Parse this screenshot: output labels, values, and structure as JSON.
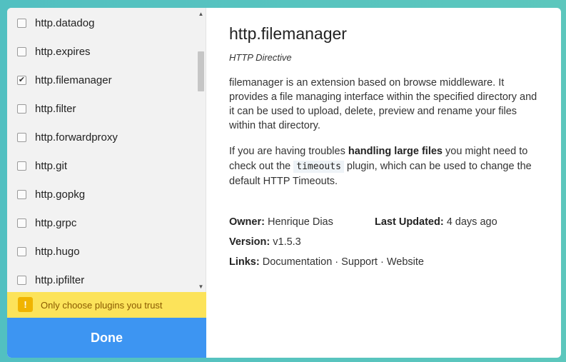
{
  "plugins": [
    {
      "name": "http.datadog",
      "checked": false
    },
    {
      "name": "http.expires",
      "checked": false
    },
    {
      "name": "http.filemanager",
      "checked": true
    },
    {
      "name": "http.filter",
      "checked": false
    },
    {
      "name": "http.forwardproxy",
      "checked": false
    },
    {
      "name": "http.git",
      "checked": false
    },
    {
      "name": "http.gopkg",
      "checked": false
    },
    {
      "name": "http.grpc",
      "checked": false
    },
    {
      "name": "http.hugo",
      "checked": false
    },
    {
      "name": "http.ipfilter",
      "checked": false
    }
  ],
  "warning": {
    "icon": "!",
    "text": "Only choose plugins you trust"
  },
  "done_label": "Done",
  "detail": {
    "title": "http.filemanager",
    "subtitle": "HTTP Directive",
    "description": "filemanager is an extension based on browse middleware. It provides a file managing interface within the specified directory and it can be used to upload, delete, preview and rename your files within that directory.",
    "note_pre": "If you are having troubles ",
    "note_bold": "handling large files",
    "note_mid": " you might need to check out the ",
    "note_code": "timeouts",
    "note_post": " plugin, which can be used to change the default HTTP Timeouts.",
    "owner_label": "Owner:",
    "owner": "Henrique Dias",
    "updated_label": "Last Updated:",
    "updated": "4 days ago",
    "version_label": "Version:",
    "version": "v1.5.3",
    "links_label": "Links:",
    "links": [
      "Documentation",
      "Support",
      "Website"
    ],
    "link_sep": " · "
  },
  "colors": {
    "accent": "#3d95f2",
    "warning_bg": "#fce35a",
    "warning_icon": "#f0b400"
  }
}
